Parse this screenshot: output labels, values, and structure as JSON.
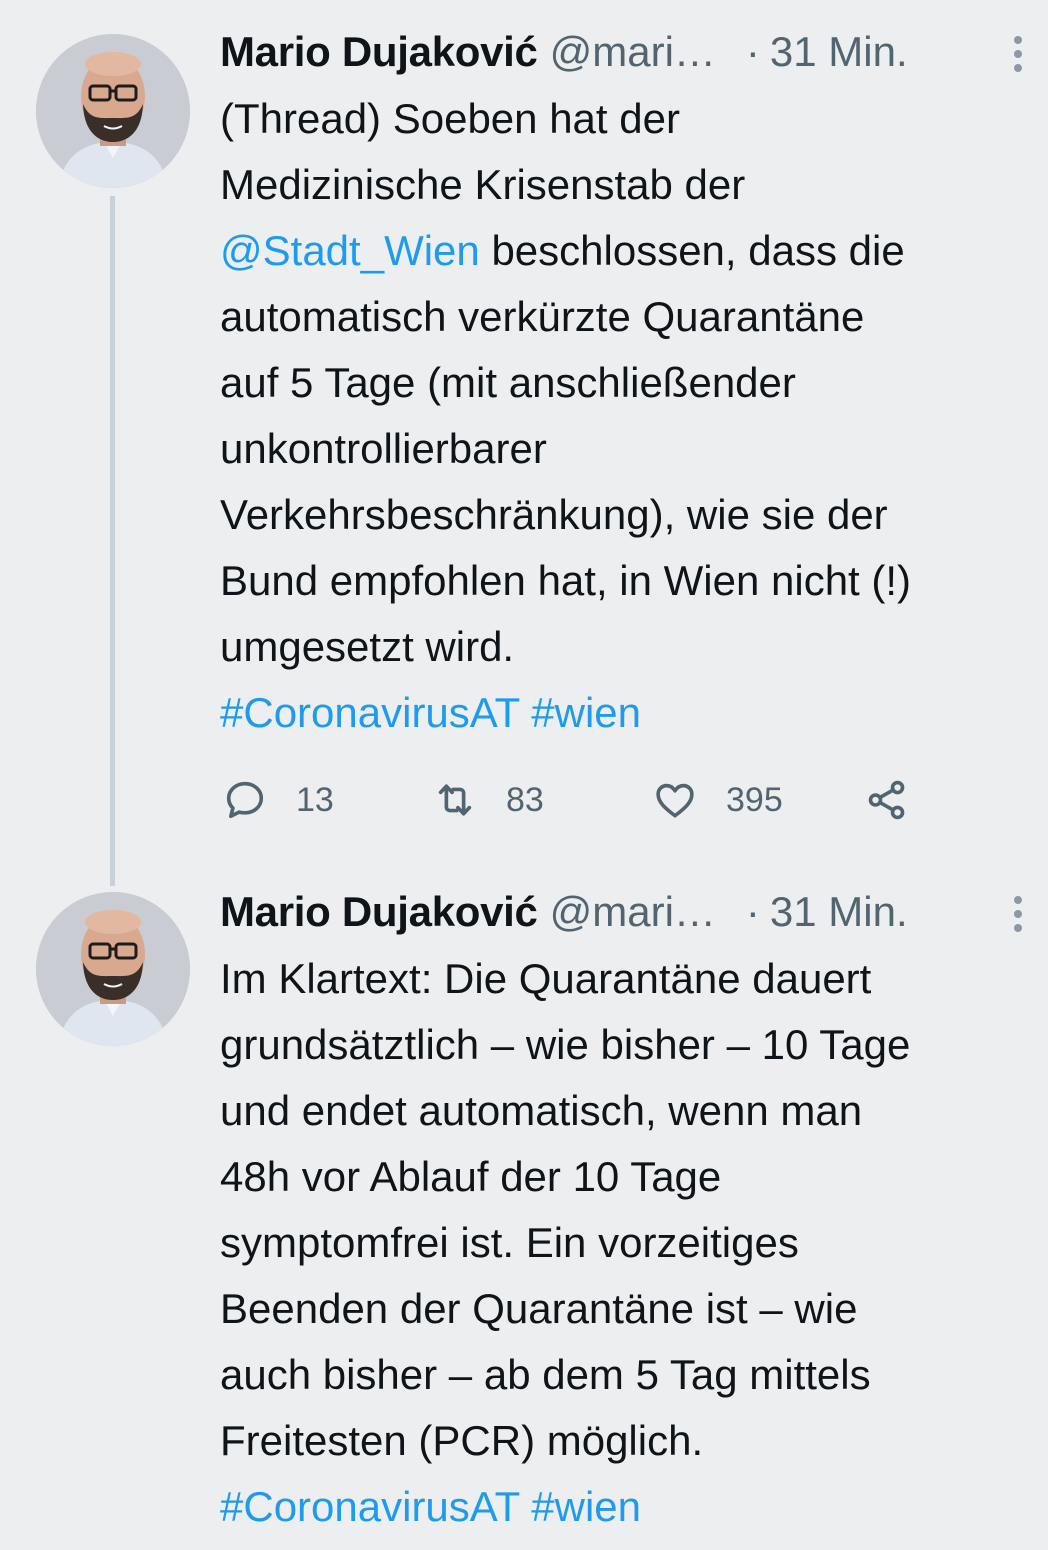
{
  "tweets": [
    {
      "author_name": "Mario Dujaković",
      "handle": "@mari…",
      "separator": "·",
      "time": "31 Min.",
      "body_lines": [
        "(Thread) Soeben hat der",
        "Medizinische Krisenstab der",
        "beschlossen, dass die",
        "automatisch verkürzte Quarantäne",
        "auf 5 Tage (mit anschließender",
        "unkontrollierbarer",
        "Verkehrsbeschränkung), wie sie der",
        "Bund empfohlen hat, in Wien nicht (!)",
        "umgesetzt wird."
      ],
      "mention": "@Stadt_Wien",
      "hashtags": [
        "#CoronavirusAT",
        "#wien"
      ],
      "reply_count": "13",
      "retweet_count": "83",
      "like_count": "395"
    },
    {
      "author_name": "Mario Dujaković",
      "handle": "@mari…",
      "separator": "·",
      "time": "31 Min.",
      "body_lines": [
        "Im Klartext: Die Quarantäne dauert",
        "grundsätztlich – wie bisher – 10 Tage",
        "und endet automatisch, wenn man",
        "48h vor Ablauf der 10 Tage",
        "symptomfrei ist. Ein vorzeitiges",
        "Beenden der Quarantäne ist – wie",
        "auch bisher – ab dem 5 Tag mittels",
        "Freitesten (PCR) möglich."
      ],
      "hashtags": [
        "#CoronavirusAT",
        "#wien"
      ]
    }
  ],
  "icons": {
    "reply": "speech-bubble",
    "retweet": "retweet-arrows",
    "like": "heart",
    "share": "share-nodes",
    "more": "vertical-dots"
  },
  "colors": {
    "background": "#edeef0",
    "text": "#0f1419",
    "secondary": "#536471",
    "link": "#1d9bf0"
  }
}
